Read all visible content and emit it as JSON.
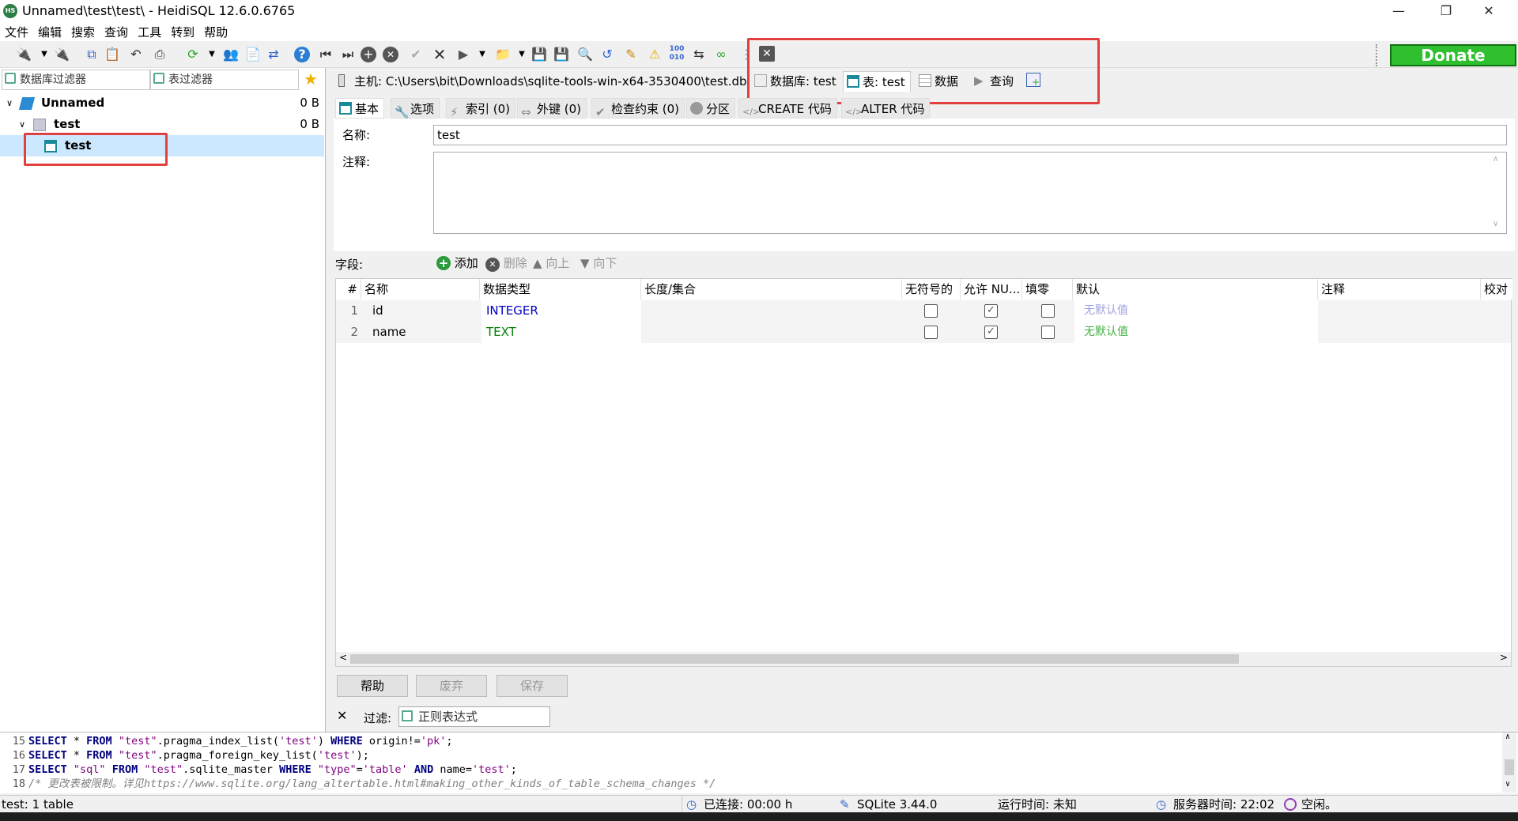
{
  "window": {
    "title": "Unnamed\\test\\test\\ - HeidiSQL 12.6.0.6765",
    "app_icon": "HS"
  },
  "menu": [
    "文件",
    "编辑",
    "搜索",
    "查询",
    "工具",
    "转到",
    "帮助"
  ],
  "donate_label": "Donate",
  "left": {
    "db_filter_placeholder": "数据库过滤器",
    "table_filter_placeholder": "表过滤器",
    "tree": [
      {
        "label": "Unnamed",
        "size": "0 B"
      },
      {
        "label": "test",
        "size": "0 B"
      },
      {
        "label": "test",
        "size": ""
      }
    ]
  },
  "tabs": {
    "host": "主机: C:\\Users\\bit\\Downloads\\sqlite-tools-win-x64-3530400\\test.db",
    "database": "数据库: test",
    "table": "表: test",
    "data": "数据",
    "query": "查询"
  },
  "subtabs": [
    "基本",
    "选项",
    "索引 (0)",
    "外键 (0)",
    "检查约束 (0)",
    "分区",
    "CREATE 代码",
    "ALTER 代码"
  ],
  "editor": {
    "name_label": "名称:",
    "name_value": "test",
    "comment_label": "注释:",
    "comment_value": ""
  },
  "fields": {
    "label": "字段:",
    "add": "添加",
    "remove": "删除",
    "up": "向上",
    "down": "向下",
    "columns": [
      "#",
      "名称",
      "数据类型",
      "长度/集合",
      "无符号的",
      "允许 NU...",
      "填零",
      "默认",
      "注释",
      "校对"
    ],
    "rows": [
      {
        "num": "1",
        "name": "id",
        "type": "INTEGER",
        "length": "",
        "unsigned": false,
        "allow_null": true,
        "zerofill": false,
        "default": "无默认值",
        "type_color": "#0000c0",
        "default_color": "#a0a0e0"
      },
      {
        "num": "2",
        "name": "name",
        "type": "TEXT",
        "length": "",
        "unsigned": false,
        "allow_null": true,
        "zerofill": false,
        "default": "无默认值",
        "type_color": "#008000",
        "default_color": "#40b040"
      }
    ]
  },
  "buttons": {
    "help": "帮助",
    "discard": "废弃",
    "save": "保存"
  },
  "filter": {
    "label": "过滤:",
    "placeholder": "正则表达式"
  },
  "sql_log": [
    {
      "num": "15"
    },
    {
      "num": "16"
    },
    {
      "num": "17"
    },
    {
      "num": "18"
    }
  ],
  "status": {
    "left": "test: 1 table",
    "connected": "已连接: 00:00 h",
    "version": "SQLite 3.44.0",
    "uptime": "运行时间: 未知",
    "server_time": "服务器时间: 22:02",
    "idle": "空闲。"
  }
}
